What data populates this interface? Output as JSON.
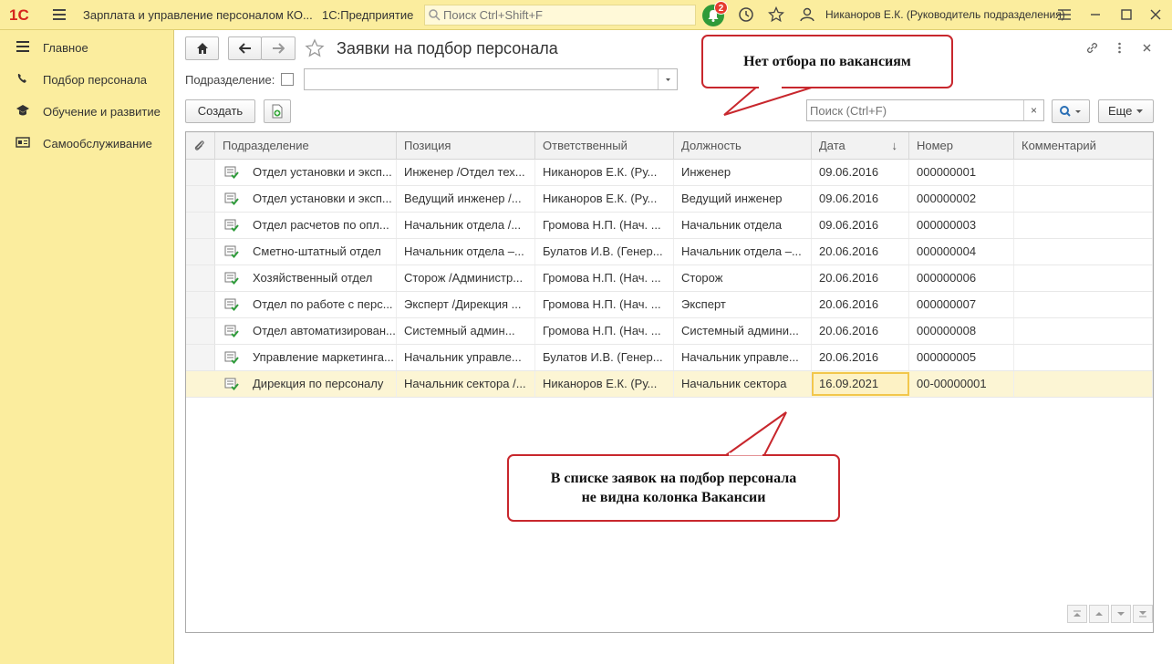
{
  "app": {
    "logo_text": "1С",
    "title": "Зарплата и управление персоналом КО...",
    "platform": "1С:Предприятие",
    "search_placeholder": "Поиск Ctrl+Shift+F",
    "notification_count": "2",
    "user": "Никаноров Е.К. (Руководитель подразделения)"
  },
  "sidebar": {
    "items": [
      {
        "label": "Главное",
        "icon": "menu-list-icon"
      },
      {
        "label": "Подбор персонала",
        "icon": "recruiting-icon"
      },
      {
        "label": "Обучение и развитие",
        "icon": "graduation-cap-icon"
      },
      {
        "label": "Самообслуживание",
        "icon": "id-card-icon"
      }
    ]
  },
  "form": {
    "title": "Заявки на подбор персонала",
    "filter_label": "Подразделение:",
    "filter_value": "",
    "create_button": "Создать",
    "search_placeholder": "Поиск (Ctrl+F)",
    "more_button": "Еще",
    "columns": [
      "Подразделение",
      "Позиция",
      "Ответственный",
      "Должность",
      "Дата",
      "Номер",
      "Комментарий"
    ],
    "rows": [
      [
        "Отдел установки и эксп...",
        "Инженер /Отдел тех...",
        "Никаноров Е.К. (Ру...",
        "Инженер",
        "09.06.2016",
        "000000001",
        ""
      ],
      [
        "Отдел установки и эксп...",
        "Ведущий инженер /...",
        "Никаноров Е.К. (Ру...",
        "Ведущий инженер",
        "09.06.2016",
        "000000002",
        ""
      ],
      [
        "Отдел расчетов по опл...",
        "Начальник отдела /...",
        "Громова Н.П. (Нач. ...",
        "Начальник отдела",
        "09.06.2016",
        "000000003",
        ""
      ],
      [
        "Сметно-штатный отдел",
        "Начальник отдела –...",
        "Булатов И.В. (Генер...",
        "Начальник отдела –...",
        "20.06.2016",
        "000000004",
        ""
      ],
      [
        "Хозяйственный отдел",
        "Сторож /Администр...",
        "Громова Н.П. (Нач. ...",
        "Сторож",
        "20.06.2016",
        "000000006",
        ""
      ],
      [
        "Отдел по работе с перс...",
        "Эксперт /Дирекция ...",
        "Громова Н.П. (Нач. ...",
        "Эксперт",
        "20.06.2016",
        "000000007",
        ""
      ],
      [
        "Отдел автоматизирован...",
        "Системный админ...",
        "Громова Н.П. (Нач. ...",
        "Системный админи...",
        "20.06.2016",
        "000000008",
        ""
      ],
      [
        "Управление маркетинга...",
        "Начальник управле...",
        "Булатов И.В. (Генер...",
        "Начальник управле...",
        "20.06.2016",
        "000000005",
        ""
      ],
      [
        "Дирекция по персоналу",
        "Начальник сектора /...",
        "Никаноров Е.К. (Ру...",
        "Начальник сектора",
        "16.09.2021",
        "00-00000001",
        ""
      ]
    ]
  },
  "annotations": {
    "top": "Нет отбора по вакансиям",
    "bottom_line1": "В списке заявок на подбор персонала",
    "bottom_line2": "не видна колонка Вакансии"
  },
  "colors": {
    "accent_yellow": "#fbed9e",
    "callout_border": "#c8272d",
    "selected_row": "#fcf5d4",
    "active_cell": "#f2c74c"
  }
}
